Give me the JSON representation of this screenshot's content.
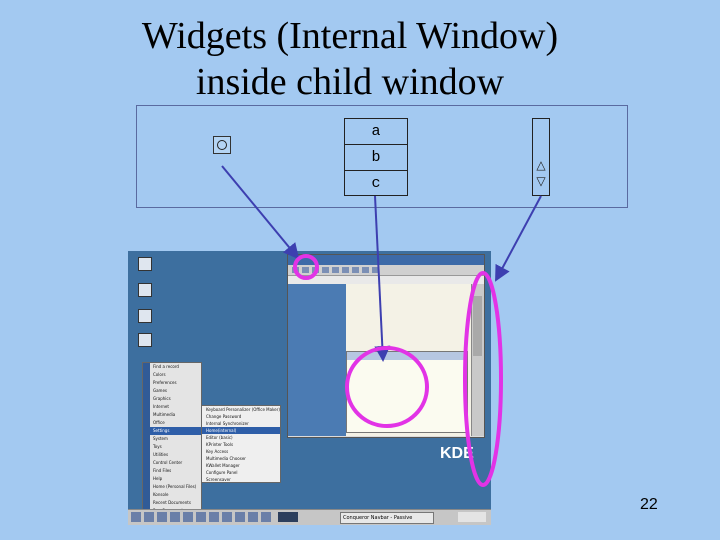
{
  "slide": {
    "title_line1": "Widgets (Internal Window)",
    "title_line2": "inside child window",
    "page_number": "22"
  },
  "widgets": {
    "list_items": [
      "a",
      "b",
      "c"
    ],
    "scroll_up_glyph": "△",
    "scroll_down_glyph": "▽"
  },
  "screenshot": {
    "kde_logo": "KDE",
    "taskbar_task": "Conqueror Navbar - Passive",
    "menu_items": [
      "Find a record",
      "Colors",
      "Preferences",
      "Games",
      "Graphics",
      "Internet",
      "Multimedia",
      "Office",
      "Settings",
      "System",
      "Toys",
      "Utilities",
      "Control Center",
      "Find Files",
      "Help",
      "Home (Personal Files)",
      "Konsole",
      "Recent Documents",
      "Run Command",
      "Configure Panel",
      "Lock Screen",
      "Logout"
    ],
    "selected_menu_index": 8,
    "submenu_items": [
      "Keyboard Personalizer (Office Maker)",
      "Change Password",
      "Internal Synchronizer",
      "Home(internal)",
      "Editor (basic)",
      "KPrinter Tools",
      "Key Access",
      "Multimedia Chooser",
      "KWallet Manager",
      "Configure Panel",
      "Screensaver"
    ],
    "selected_submenu_index": 3
  },
  "colors": {
    "slide_bg": "#a3c9f1",
    "highlight_magenta": "#e233e6",
    "arrow_blue": "#3d3fb0"
  }
}
